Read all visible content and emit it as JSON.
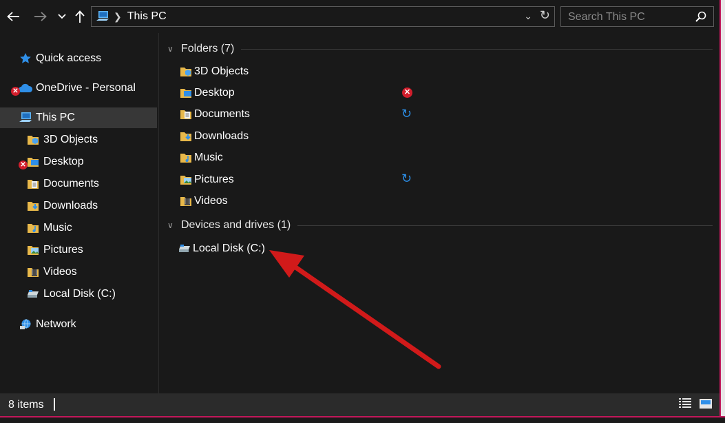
{
  "window": {
    "title": "This PC"
  },
  "address": {
    "current": "This PC"
  },
  "search": {
    "placeholder": "Search This PC"
  },
  "nav": {
    "items": [
      {
        "label": "Quick access"
      },
      {
        "label": "OneDrive - Personal"
      },
      {
        "label": "This PC"
      },
      {
        "label": "3D Objects"
      },
      {
        "label": "Desktop"
      },
      {
        "label": "Documents"
      },
      {
        "label": "Downloads"
      },
      {
        "label": "Music"
      },
      {
        "label": "Pictures"
      },
      {
        "label": "Videos"
      },
      {
        "label": "Local Disk (C:)"
      },
      {
        "label": "Network"
      }
    ],
    "selected": "This PC"
  },
  "content": {
    "groups": [
      {
        "title": "Folders (7)",
        "items": [
          {
            "label": "3D Objects",
            "status": ""
          },
          {
            "label": "Desktop",
            "status": "error"
          },
          {
            "label": "Documents",
            "status": "sync"
          },
          {
            "label": "Downloads",
            "status": ""
          },
          {
            "label": "Music",
            "status": ""
          },
          {
            "label": "Pictures",
            "status": "sync"
          },
          {
            "label": "Videos",
            "status": ""
          }
        ]
      },
      {
        "title": "Devices and drives (1)",
        "items": [
          {
            "label": "Local Disk (C:)",
            "status": ""
          }
        ]
      }
    ]
  },
  "statusbar": {
    "item_count": "8 items"
  },
  "icons": {
    "back": "back-arrow-icon",
    "forward": "forward-arrow-icon",
    "recent": "chevron-down-icon",
    "up": "up-arrow-icon",
    "refresh": "refresh-icon",
    "search": "search-icon",
    "annotation": "red-arrow-annotation"
  },
  "colors": {
    "background": "#191919",
    "selected": "#373737",
    "statusbar": "#2b2b2b",
    "error": "#d21e2c",
    "sync": "#2c8fe8",
    "folder": "#e8b84a",
    "annotation_arrow": "#d11a1a",
    "window_border": "#c2185b"
  }
}
